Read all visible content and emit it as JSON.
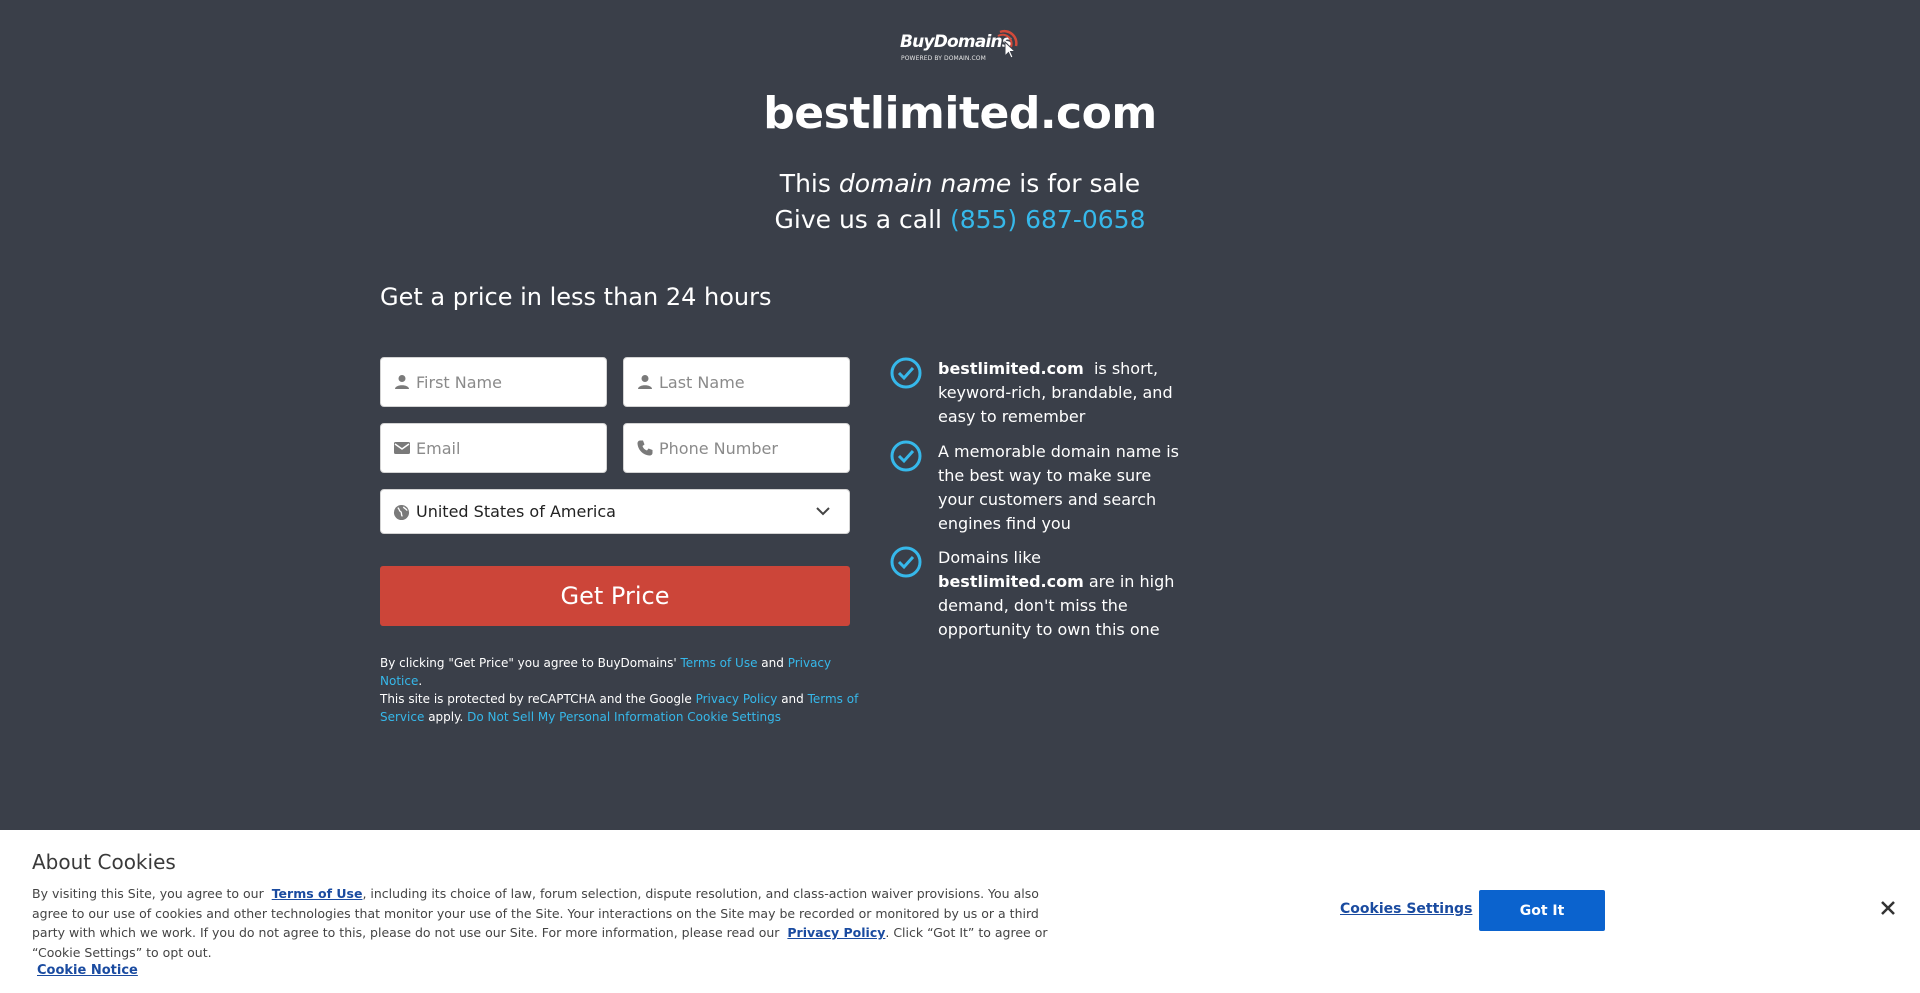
{
  "logo": {
    "name": "BuyDomains",
    "tagline": "POWERED BY DOMAIN.COM"
  },
  "domain": "bestlimited.com",
  "sale_line": {
    "prefix": "This",
    "emphasis": "domain name",
    "suffix": "is for sale"
  },
  "call_line": {
    "prefix": "Give us a call",
    "phone": "(855) 687-0658"
  },
  "form": {
    "heading": "Get a price in less than 24 hours",
    "first_name_placeholder": "First Name",
    "last_name_placeholder": "Last Name",
    "email_placeholder": "Email",
    "phone_placeholder": "Phone Number",
    "country": "United States of America",
    "submit_label": "Get Price"
  },
  "legal": {
    "part1": "By clicking \"Get Price\" you agree to BuyDomains'",
    "terms_of_use": "Terms of Use",
    "and1": "and",
    "privacy_notice": "Privacy Notice",
    "part2": "This site is protected by reCAPTCHA and the Google",
    "privacy_policy": "Privacy Policy",
    "and2": "and",
    "terms_of_service": "Terms of Service",
    "apply": "apply.",
    "do_not_sell": "Do Not Sell My Personal Information",
    "cookie_settings": "Cookie Settings"
  },
  "benefits": {
    "b1_domain": "bestlimited.com",
    "b1_text": "is short, keyword-rich, brandable, and easy to remember",
    "b2_text": "A memorable domain name is the best way to make sure your customers and search engines find you",
    "b3_prefix": "Domains like",
    "b3_domain": "bestlimited.com",
    "b3_suffix": "are in high demand, don't miss the opportunity to own this one"
  },
  "cookie": {
    "title": "About Cookies",
    "text1": "By visiting this Site, you agree to our",
    "terms_link": "Terms of Use",
    "text2": ", including its choice of law, forum selection, dispute resolution, and class-action waiver provisions. You also agree to our use of cookies and other technologies that monitor your use of the Site. Your interactions on the Site may be recorded or monitored by us or a third party with which we work. If you do not agree to this, please do not use our Site. For more information, please read our",
    "privacy_link": "Privacy Policy",
    "text3": ". Click “Got It” to agree or “Cookie Settings” to opt out.",
    "notice_link": "Cookie Notice",
    "settings_label": "Cookies Settings",
    "got_it_label": "Got It"
  },
  "colors": {
    "background": "#3a3f49",
    "accent_link": "#36b8ea",
    "cta": "#cc4539",
    "got_it": "#0b63ce"
  }
}
